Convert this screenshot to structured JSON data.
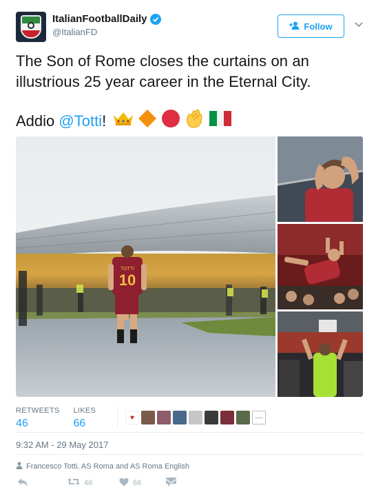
{
  "user": {
    "display_name": "ItalianFootballDaily",
    "handle": "@ItalianFD",
    "verified": true,
    "avatar_icon": "club-crest-avatar"
  },
  "follow": {
    "label": "Follow",
    "icon": "add-user-icon"
  },
  "tweet": {
    "text": "The Son of Rome closes the curtains on an illustrious 25 year career in the Eternal City.",
    "addio_prefix": "Addio ",
    "mention": "@Totti",
    "addio_suffix": "!",
    "emojis": [
      "crown-emoji",
      "orange-diamond-emoji",
      "red-circle-emoji",
      "clapping-hands-emoji",
      "italy-flag-emoji"
    ]
  },
  "media": {
    "main_alt": "stadium-player-walking-photo",
    "side": [
      "player-hands-on-head-photo",
      "player-lifted-by-team-photo",
      "player-green-bib-photo"
    ],
    "jersey_name": "TOTTI",
    "jersey_number": "10"
  },
  "stats": {
    "retweets_label": "RETWEETS",
    "retweets_value": "46",
    "likes_label": "LIKES",
    "likes_value": "66"
  },
  "timestamp": "9:32 AM - 29 May 2017",
  "mentioned_users": "Francesco Totti, AS Roma and AS Roma English",
  "actions": {
    "reply_icon": "reply-icon",
    "retweet_count": "46",
    "like_count": "66",
    "dm_icon": "direct-message-icon"
  },
  "colors": {
    "accent": "#1da1f2",
    "muted": "#657786",
    "roma_red": "#8e1f2f",
    "roma_gold": "#f0bc42"
  }
}
